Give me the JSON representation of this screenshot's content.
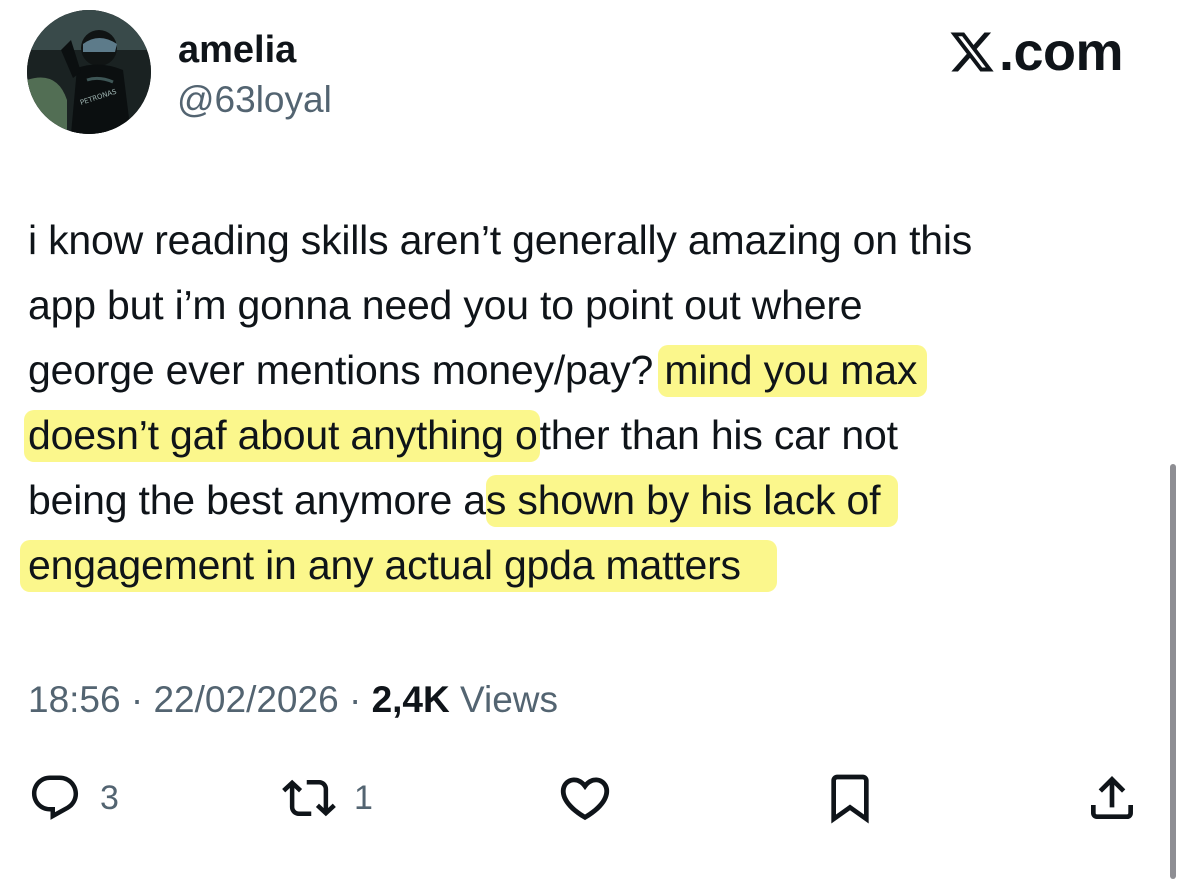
{
  "author": {
    "name": "amelia",
    "handle": "@63loyal",
    "avatar_text": "PETRONAS"
  },
  "site": {
    "domain_suffix": ".com",
    "logo_icon": "x-logo-icon"
  },
  "tweet": {
    "lines": [
      {
        "plain_a": "i know reading skills aren’t generally amazing on this",
        "highlight": "",
        "plain_b": ""
      },
      {
        "plain_a": "app but i’m gonna need you to point out where",
        "highlight": "",
        "plain_b": ""
      },
      {
        "plain_a": "george ever mentions money/pay? ",
        "highlight": "mind you max",
        "plain_b": ""
      },
      {
        "plain_a": "",
        "highlight": "doesn’t gaf about anything o",
        "plain_b": "ther than his car not"
      },
      {
        "plain_a": "being the best anymore a",
        "highlight": "s shown by his lack of",
        "plain_b": ""
      },
      {
        "plain_a": "",
        "highlight": "engagement in any actual gpda matters",
        "plain_b": ""
      }
    ],
    "highlight_color": "#fbf78c"
  },
  "meta": {
    "time": "18:56",
    "date": "22/02/2026",
    "separator": "·",
    "views_count": "2,4K",
    "views_label": "Views"
  },
  "actions": {
    "replies": {
      "icon": "reply-icon",
      "count": "3"
    },
    "reposts": {
      "icon": "repost-icon",
      "count": "1"
    },
    "likes": {
      "icon": "like-icon",
      "count": ""
    },
    "bookmark": {
      "icon": "bookmark-icon"
    },
    "share": {
      "icon": "share-icon"
    }
  },
  "colors": {
    "text": "#0f1419",
    "secondary": "#536471",
    "highlight": "#fbf78c"
  }
}
